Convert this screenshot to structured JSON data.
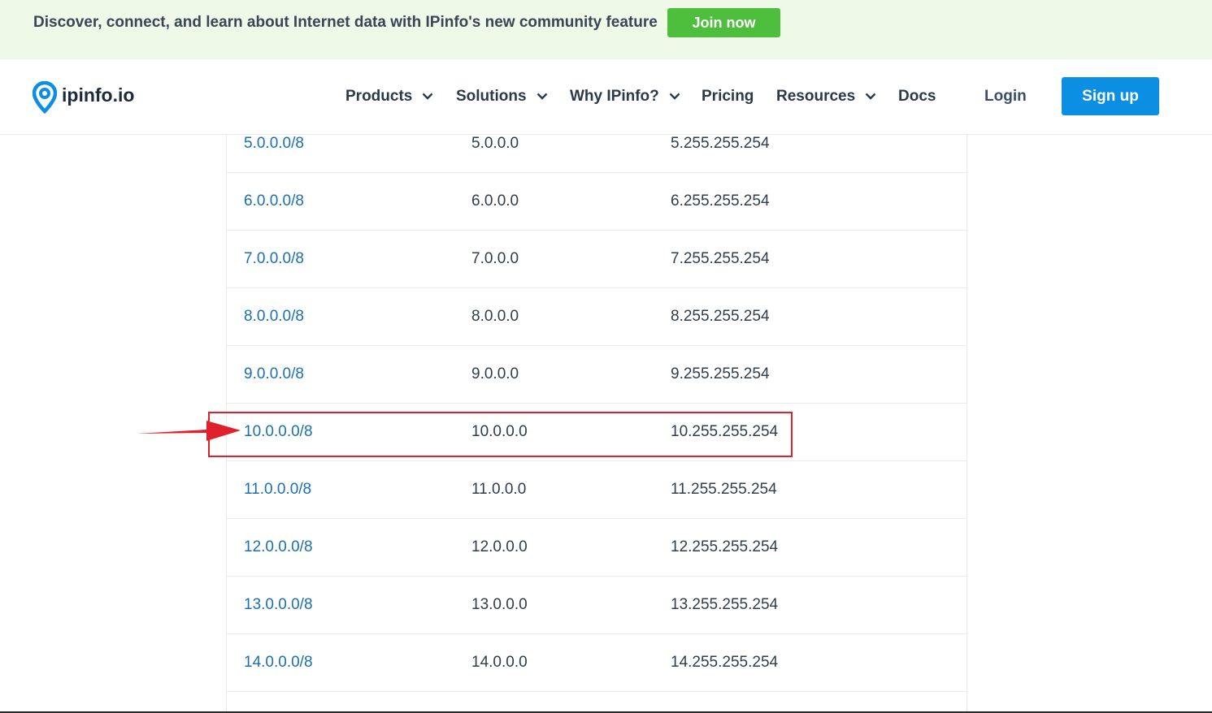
{
  "banner": {
    "text": "Discover, connect, and learn about Internet data with IPinfo's new community feature",
    "cta": "Join now"
  },
  "header": {
    "logo_text": "ipinfo.io",
    "nav": [
      {
        "label": "Products",
        "has_dropdown": true
      },
      {
        "label": "Solutions",
        "has_dropdown": true
      },
      {
        "label": "Why IPinfo?",
        "has_dropdown": true
      },
      {
        "label": "Pricing",
        "has_dropdown": false
      },
      {
        "label": "Resources",
        "has_dropdown": true
      },
      {
        "label": "Docs",
        "has_dropdown": false
      }
    ],
    "login": "Login",
    "signup": "Sign up"
  },
  "table": {
    "rows": [
      {
        "range": "5.0.0.0/8",
        "start": "5.0.0.0",
        "end": "5.255.255.254"
      },
      {
        "range": "6.0.0.0/8",
        "start": "6.0.0.0",
        "end": "6.255.255.254"
      },
      {
        "range": "7.0.0.0/8",
        "start": "7.0.0.0",
        "end": "7.255.255.254"
      },
      {
        "range": "8.0.0.0/8",
        "start": "8.0.0.0",
        "end": "8.255.255.254"
      },
      {
        "range": "9.0.0.0/8",
        "start": "9.0.0.0",
        "end": "9.255.255.254"
      },
      {
        "range": "10.0.0.0/8",
        "start": "10.0.0.0",
        "end": "10.255.255.254",
        "highlighted": true
      },
      {
        "range": "11.0.0.0/8",
        "start": "11.0.0.0",
        "end": "11.255.255.254"
      },
      {
        "range": "12.0.0.0/8",
        "start": "12.0.0.0",
        "end": "12.255.255.254"
      },
      {
        "range": "13.0.0.0/8",
        "start": "13.0.0.0",
        "end": "13.255.255.254"
      },
      {
        "range": "14.0.0.0/8",
        "start": "14.0.0.0",
        "end": "14.255.255.254"
      }
    ]
  },
  "colors": {
    "banner_bg": "#eef9e8",
    "join_button": "#4ebf3d",
    "signup_button": "#0b8fe3",
    "link": "#1a6fb5",
    "highlight": "#e0202a"
  },
  "icons": {
    "logo": "location-pin-icon",
    "dropdown": "chevron-down-icon",
    "annotation": "red-arrow-icon"
  }
}
